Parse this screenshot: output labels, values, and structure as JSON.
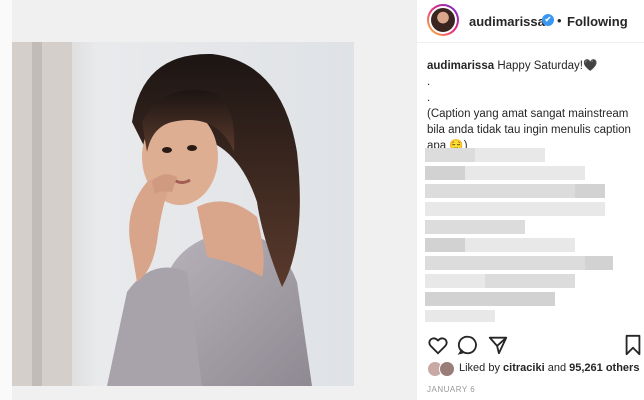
{
  "header": {
    "username": "audimarissa",
    "verified_mark": "✔",
    "separator": "•",
    "follow_status": "Following"
  },
  "caption": {
    "username": "audimarissa",
    "text": "Happy Saturday!",
    "emoji": "🖤",
    "line2": ".",
    "line3": ".",
    "line4": "(Caption yang amat sangat mainstream bila anda tidak tau ingin menulis caption apa",
    "line4_emoji": "😌",
    "line4_end": ")"
  },
  "actions": {
    "like_icon": "heart-outline-icon",
    "comment_icon": "comment-bubble-icon",
    "share_icon": "share-paper-plane-icon",
    "save_icon": "bookmark-icon"
  },
  "likes": {
    "prefix": "Liked by",
    "user": "citraciki",
    "connector": "and",
    "others": "95,261 others"
  },
  "date": "JANUARY 6",
  "colors": {
    "verified": "#3897f0",
    "text": "#262626",
    "muted": "#999999"
  }
}
